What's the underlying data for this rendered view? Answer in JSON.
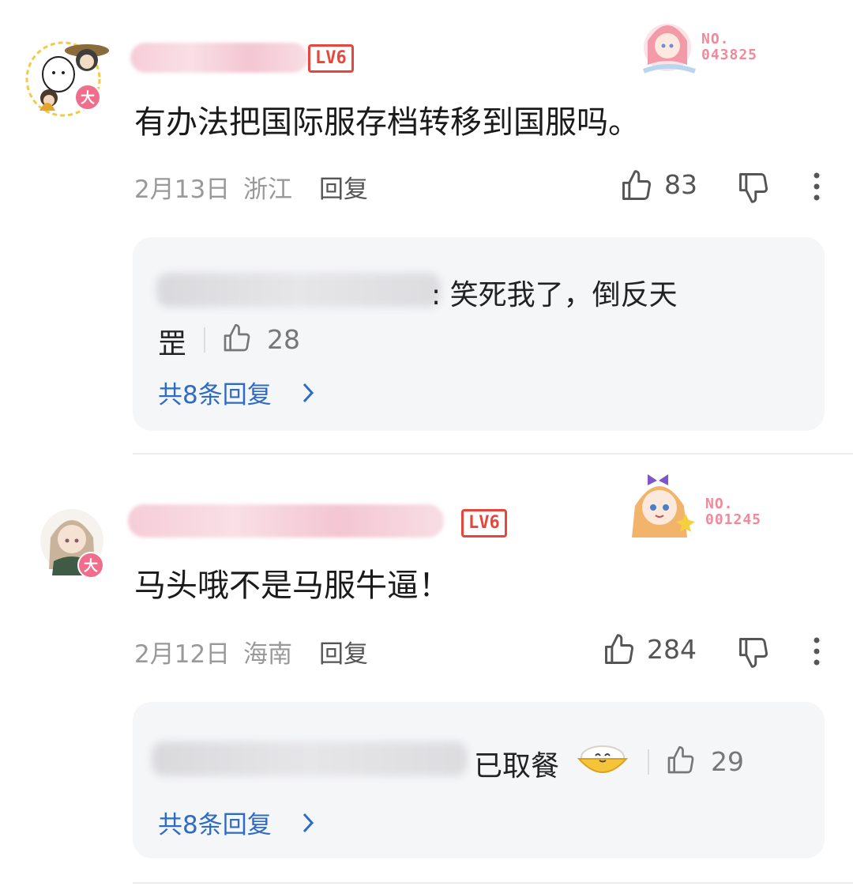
{
  "comments": [
    {
      "level": "LV6",
      "avatar_badge": "大",
      "fan_badge": "NO.\n043825",
      "text": "有办法把国际服存档转移到国服吗。",
      "date": "2月13日",
      "location": "浙江",
      "reply_label": "回复",
      "likes": "83",
      "replies_preview": {
        "text_line1": ": 笑死我了，倒反天",
        "text_line2": "罡",
        "likes": "28"
      },
      "total_replies_label": "共8条回复"
    },
    {
      "level": "LV6",
      "avatar_badge": "大",
      "fan_badge": "NO.\n001245",
      "text": "马头哦不是马服牛逼！",
      "date": "2月12日",
      "location": "海南",
      "reply_label": "回复",
      "likes": "284",
      "replies_preview": {
        "text_line1": "已取餐",
        "likes": "29"
      },
      "total_replies_label": "共8条回复"
    }
  ],
  "icons": [
    "thumbs-up-icon",
    "thumbs-down-icon",
    "more-vertical-icon",
    "chevron-right-icon",
    "rice-bowl-emoji-icon"
  ],
  "colors": {
    "accent_link": "#2f6bc6",
    "level_badge": "#e8453c",
    "avatar_badge": "#f06d8c",
    "reply_bg": "#f5f6f8"
  }
}
